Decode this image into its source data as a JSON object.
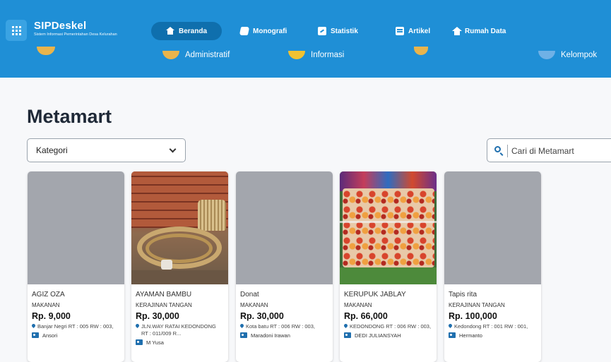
{
  "header": {
    "brand_name": "SIPDeskel",
    "brand_subtitle": "Sistem Informasi Pemerintahan Desa Kelurahan",
    "nav": [
      {
        "label": "Beranda",
        "icon": "home-icon",
        "active": true
      },
      {
        "label": "Monografi",
        "icon": "flag-icon"
      },
      {
        "label": "Statistik",
        "icon": "chart-icon"
      },
      {
        "label": "Artikel",
        "icon": "document-icon"
      },
      {
        "label": "Rumah Data",
        "icon": "house-icon"
      }
    ],
    "categories": [
      "",
      "Administratif",
      "Informasi",
      "",
      "Kelompok"
    ],
    "color": "#1f8fd6"
  },
  "main": {
    "title": "Metamart",
    "filter": {
      "selected": "Kategori"
    },
    "search": {
      "placeholder": "Cari di Metamart"
    }
  },
  "products": [
    {
      "name": "AGIZ OZA",
      "category": "MAKANAN",
      "price": "Rp. 9,000",
      "address": "Banjar Negri RT : 005 RW : 003,",
      "seller": "Ansori",
      "image": "placeholder"
    },
    {
      "name": "AYAMAN BAMBU",
      "category": "KERAJINAN TANGAN",
      "price": "Rp. 30,000",
      "address": "JLN.WAY RATAI KEDONDONG RT : 011/009 R...",
      "seller": "M Yusa",
      "image": "bamboo-craft-photo"
    },
    {
      "name": "Donat",
      "category": "MAKANAN",
      "price": "Rp. 30,000",
      "address": "Kota batu RT : 006 RW : 003,",
      "seller": "Maradoni Irawan",
      "image": "placeholder"
    },
    {
      "name": "KERUPUK JABLAY",
      "category": "MAKANAN",
      "price": "Rp. 66,000",
      "address": "KEDONDONG RT : 006 RW : 003,",
      "seller": "DEDI JULIANSYAH",
      "image": "kerupuk-photo"
    },
    {
      "name": "Tapis rita",
      "category": "KERAJINAN TANGAN",
      "price": "Rp. 100,000",
      "address": "Kedondong RT : 001 RW : 001,",
      "seller": "Hermanto",
      "image": "placeholder"
    }
  ]
}
